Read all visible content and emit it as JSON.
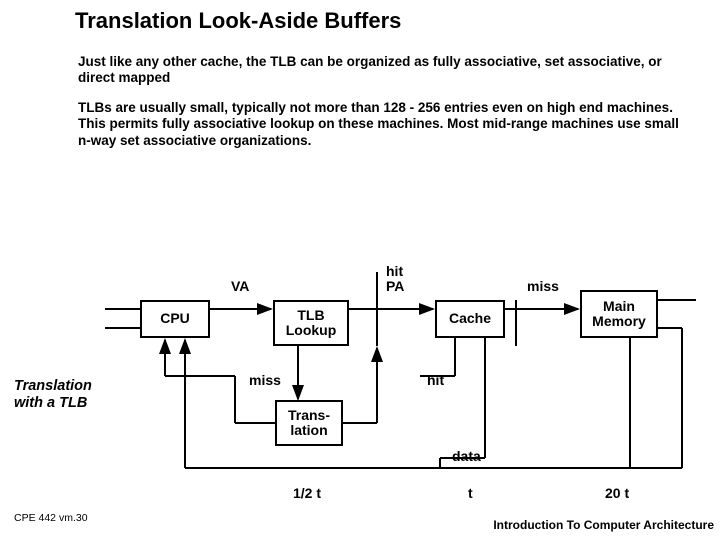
{
  "title": "Translation Look-Aside Buffers",
  "para1": "Just like any other cache, the TLB can be organized as fully associative, set associative, or direct mapped",
  "para2": "TLBs are usually small, typically not more than 128 - 256 entries even on high end machines.  This permits fully associative lookup on these machines.  Most mid-range machines use small n-way set associative organizations.",
  "caption_l1": "Translation",
  "caption_l2": "with a TLB",
  "labels": {
    "va": "VA",
    "hit": "hit",
    "pa": "PA",
    "miss_top": "miss",
    "miss_below": "miss",
    "hit_below": "hit",
    "data": "data",
    "t_half": "1/2 t",
    "t": "t",
    "t20": "20 t"
  },
  "boxes": {
    "cpu": "CPU",
    "tlb": "TLB Lookup",
    "cache": "Cache",
    "mem": "Main Memory",
    "trans": "Trans- lation"
  },
  "footer": {
    "left": "CPE 442  vm.30",
    "right": "Introduction To Computer Architecture"
  },
  "chart_data": {
    "type": "diagram",
    "title": "Translation with a TLB",
    "nodes": [
      {
        "id": "cpu",
        "label": "CPU"
      },
      {
        "id": "tlb",
        "label": "TLB Lookup"
      },
      {
        "id": "cache",
        "label": "Cache"
      },
      {
        "id": "mem",
        "label": "Main Memory"
      },
      {
        "id": "trans",
        "label": "Translation"
      }
    ],
    "edges": [
      {
        "from": "cpu",
        "to": "tlb",
        "label": "VA"
      },
      {
        "from": "tlb",
        "to": "cache",
        "label": "hit PA"
      },
      {
        "from": "cache",
        "to": "mem",
        "label": "miss"
      },
      {
        "from": "tlb",
        "to": "trans",
        "label": "miss"
      },
      {
        "from": "trans",
        "to": "cache",
        "label": ""
      },
      {
        "from": "cache",
        "to": "cpu",
        "label": "hit (data)"
      },
      {
        "from": "mem",
        "to": "cpu",
        "label": "data"
      }
    ],
    "timings": [
      {
        "stage": "TLB Lookup / Translation",
        "time": "1/2 t"
      },
      {
        "stage": "Cache",
        "time": "t"
      },
      {
        "stage": "Main Memory",
        "time": "20 t"
      }
    ]
  }
}
